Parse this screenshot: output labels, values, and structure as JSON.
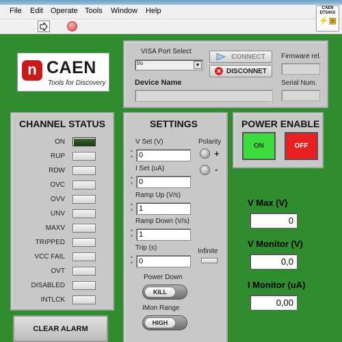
{
  "menu": [
    "File",
    "Edit",
    "Operate",
    "Tools",
    "Window",
    "Help"
  ],
  "toolbar": {
    "run_icon": "run-arrow-icon",
    "stop_icon": "stop-icon"
  },
  "corner_badge": {
    "line1": "CAEN",
    "line2": "DT54XX"
  },
  "logo": {
    "brand": "CAEN",
    "tagline": "Tools for Discovery",
    "mark": "n"
  },
  "connection": {
    "visa_label": "VISA Port Select",
    "visa_value": "I/o",
    "connect_label": "CONNECT",
    "disconnect_label": "DISCONNET",
    "firmware_label": "Firmware rel.",
    "device_name_label": "Device Name",
    "serial_label": "Serial Num."
  },
  "channel_status": {
    "title": "CHANNEL STATUS",
    "items": [
      {
        "label": "ON",
        "on": true
      },
      {
        "label": "RUP",
        "on": false
      },
      {
        "label": "RDW",
        "on": false
      },
      {
        "label": "OVC",
        "on": false
      },
      {
        "label": "OVV",
        "on": false
      },
      {
        "label": "UNV",
        "on": false
      },
      {
        "label": "MAXV",
        "on": false
      },
      {
        "label": "TRIPPED",
        "on": false
      },
      {
        "label": "VCC FAIL",
        "on": false
      },
      {
        "label": "OVT",
        "on": false
      },
      {
        "label": "DISABLED",
        "on": false
      },
      {
        "label": "INTLCK",
        "on": false
      }
    ],
    "clear_label": "CLEAR ALARM"
  },
  "settings": {
    "title": "SETTINGS",
    "vset_label": "V Set (V)",
    "vset_value": "0",
    "iset_label": "I Set (uA)",
    "iset_value": "0",
    "rampup_label": "Ramp Up (V/s)",
    "rampup_value": "1",
    "rampdown_label": "Ramp Down (V/s)",
    "rampdown_value": "1",
    "trip_label": "Trip (s)",
    "trip_value": "0",
    "polarity_label": "Polarity",
    "plus": "+",
    "minus": "-",
    "infinite_label": "Infinite",
    "powerdown_label": "Power Down",
    "powerdown_value": "KILL",
    "imon_label": "IMon Range",
    "imon_value": "HIGH"
  },
  "power_enable": {
    "title": "POWER ENABLE",
    "on_label": "ON",
    "off_label": "OFF"
  },
  "monitors": {
    "vmax_label": "V Max (V)",
    "vmax_value": "0",
    "vmon_label": "V Monitor (V)",
    "vmon_value": "0,0",
    "imon_label": "I Monitor (uA)",
    "imon_value": "0,00"
  },
  "colors": {
    "background": "#2f8d2f",
    "on_button": "#3ddc3d",
    "off_button": "#e82020",
    "led_on": "#2b5020"
  }
}
